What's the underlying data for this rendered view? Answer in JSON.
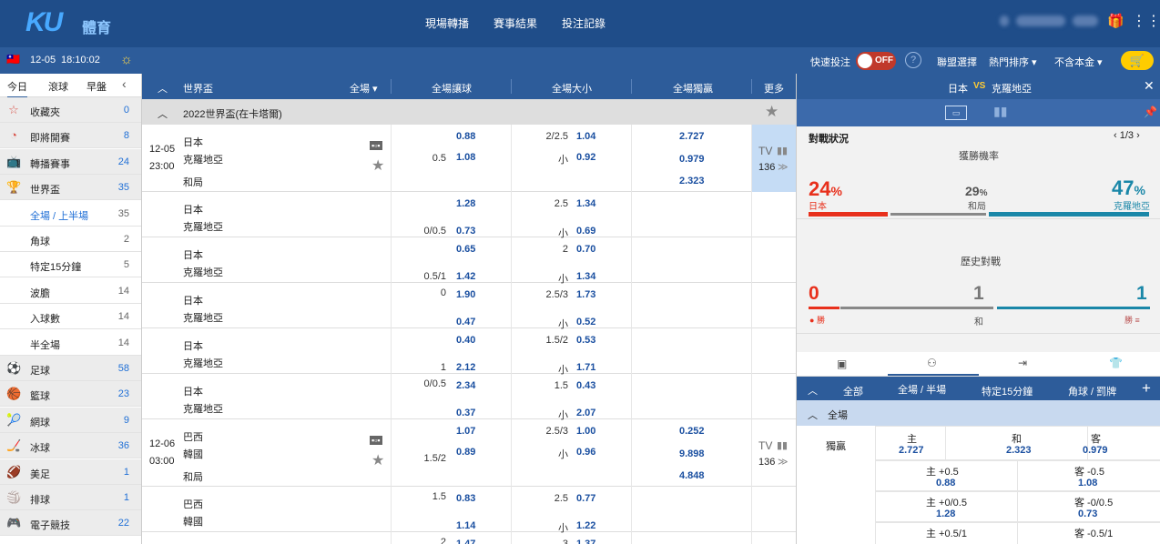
{
  "header": {
    "logo": "KU",
    "logo_sub": "體育",
    "nav": [
      "現場轉播",
      "賽事結果",
      "投注記錄"
    ]
  },
  "subbar": {
    "date": "12-05",
    "time": "18:10:02",
    "quick_bet": "快速投注",
    "toggle": "OFF",
    "league_select": "聯盟選擇",
    "sort": "熱門排序",
    "stake": "不含本金"
  },
  "left": {
    "tabs": [
      "今日",
      "滾球",
      "早盤"
    ],
    "items": [
      {
        "icon": "☆",
        "label": "收藏夾",
        "count": "0",
        "grey": true,
        "icon_name": "star-icon"
      },
      {
        "icon": "◔",
        "label": "即將開賽",
        "count": "8",
        "grey": true,
        "icon_name": "clock-icon"
      },
      {
        "icon": "📺",
        "label": "轉播賽事",
        "count": "24",
        "grey": true,
        "icon_name": "tv-icon"
      },
      {
        "icon": "🏆",
        "label": "世界盃",
        "count": "35",
        "grey": true,
        "icon_name": "trophy-icon"
      },
      {
        "icon": "",
        "label": "全場 / 上半場",
        "count": "35",
        "sub": true,
        "active": true
      },
      {
        "icon": "",
        "label": "角球",
        "count": "2",
        "sub": true
      },
      {
        "icon": "",
        "label": "特定15分鐘",
        "count": "5",
        "sub": true
      },
      {
        "icon": "",
        "label": "波膽",
        "count": "14",
        "sub": true
      },
      {
        "icon": "",
        "label": "入球數",
        "count": "14",
        "sub": true
      },
      {
        "icon": "",
        "label": "半全場",
        "count": "14",
        "sub": true
      },
      {
        "icon": "⚽",
        "label": "足球",
        "count": "58",
        "grey": true,
        "icon_name": "soccer-icon"
      },
      {
        "icon": "🏀",
        "label": "籃球",
        "count": "23",
        "grey": true,
        "icon_name": "basketball-icon"
      },
      {
        "icon": "🎾",
        "label": "網球",
        "count": "9",
        "grey": true,
        "icon_name": "tennis-icon"
      },
      {
        "icon": "🏒",
        "label": "冰球",
        "count": "36",
        "grey": true,
        "icon_name": "hockey-icon"
      },
      {
        "icon": "🏈",
        "label": "美足",
        "count": "1",
        "grey": true,
        "icon_name": "football-icon"
      },
      {
        "icon": "🏐",
        "label": "排球",
        "count": "1",
        "grey": true,
        "icon_name": "volleyball-icon"
      },
      {
        "icon": "🎮",
        "label": "電子競技",
        "count": "22",
        "grey": true,
        "icon_name": "esports-icon"
      }
    ]
  },
  "center": {
    "header": {
      "league": "世界盃",
      "period": "全場",
      "h1": "全場讓球",
      "h2": "全場大小",
      "h3": "全場獨贏",
      "more": "更多"
    },
    "league_name": "2022世界盃(在卡塔爾)",
    "rows": [
      {
        "date": "12-05",
        "time": "23:00",
        "home": "日本",
        "away": "克羅地亞",
        "draw": "和局",
        "hdp_line": "0.5",
        "hdp_home": "0.88",
        "hdp_away": "1.08",
        "ou_line": "2/2.5",
        "ou_under": "小",
        "ou_over": "1.04",
        "ou_u": "0.92",
        "x1": "2.727",
        "x2": "0.979",
        "xd": "2.323",
        "tv": "TV",
        "more": "136"
      },
      {
        "home": "日本",
        "away": "克羅地亞",
        "hdp_line": "0/0.5",
        "hdp_home": "1.28",
        "hdp_away": "0.73",
        "ou_line": "2.5",
        "ou_under": "小",
        "ou_over": "1.34",
        "ou_u": "0.69"
      },
      {
        "home": "日本",
        "away": "克羅地亞",
        "hdp_line": "0.5/1",
        "hdp_home": "0.65",
        "hdp_away": "1.42",
        "ou_line": "2",
        "ou_under": "小",
        "ou_over": "0.70",
        "ou_u": "1.34"
      },
      {
        "home": "日本",
        "away": "克羅地亞",
        "hdp_line": "0",
        "hdp_home": "1.90",
        "hdp_away": "0.47",
        "ou_line": "2.5/3",
        "ou_under": "小",
        "ou_over": "1.73",
        "ou_u": "0.52"
      },
      {
        "home": "日本",
        "away": "克羅地亞",
        "hdp_line": "1",
        "hdp_home": "0.40",
        "hdp_away": "2.12",
        "ou_line": "1.5/2",
        "ou_under": "小",
        "ou_over": "0.53",
        "ou_u": "1.71"
      },
      {
        "home": "日本",
        "away": "克羅地亞",
        "hdp_line": "0/0.5",
        "hdp_home": "2.34",
        "hdp_away": "0.37",
        "ou_line": "1.5",
        "ou_under": "小",
        "ou_over": "0.43",
        "ou_u": "2.07"
      },
      {
        "date": "12-06",
        "time": "03:00",
        "home": "巴西",
        "away": "韓國",
        "draw": "和局",
        "hdp_line": "1.5/2",
        "hdp_home": "1.07",
        "hdp_away": "0.89",
        "ou_line": "2.5/3",
        "ou_under": "小",
        "ou_over": "1.00",
        "ou_u": "0.96",
        "x1": "0.252",
        "x2": "9.898",
        "xd": "4.848",
        "tv": "TV",
        "more": "136"
      },
      {
        "home": "巴西",
        "away": "韓國",
        "hdp_line": "1.5",
        "hdp_home": "0.83",
        "hdp_away": "1.14",
        "ou_line": "2.5",
        "ou_under": "小",
        "ou_over": "0.77",
        "ou_u": "1.22"
      },
      {
        "home": "巴西",
        "hdp_line": "2",
        "hdp_home": "1.47",
        "ou_line": "3",
        "ou_over": "1.37"
      }
    ]
  },
  "right": {
    "title_home": "日本",
    "vs": "VS",
    "title_away": "克羅地亞",
    "stats_title": "對戰狀況",
    "page": "1/3",
    "win_prob": "獲勝機率",
    "p_home": "24",
    "p_draw": "29",
    "p_away": "47",
    "pct": "%",
    "l_home": "日本",
    "l_draw": "和局",
    "l_away": "克羅地亞",
    "h2h": "歷史對戰",
    "h_home": "0",
    "h_draw": "1",
    "h_away": "1",
    "h_win": "勝",
    "h_tie": "和",
    "tabs": [
      "全部",
      "全場 / 半場",
      "特定15分鐘",
      "角球 / 罰牌"
    ],
    "section": "全場",
    "market": "獨贏",
    "x_home": "主",
    "x_draw": "和",
    "x_away": "客",
    "x1": "2.727",
    "xd": "2.323",
    "x2": "0.979",
    "hdp": [
      {
        "hl": "主 +0.5",
        "ho": "0.88",
        "al": "客 -0.5",
        "ao": "1.08"
      },
      {
        "hl": "主 +0/0.5",
        "ho": "1.28",
        "al": "客 -0/0.5",
        "ao": "0.73"
      },
      {
        "hl": "主 +0.5/1",
        "ho": "",
        "al": "客 -0.5/1",
        "ao": ""
      }
    ]
  },
  "colors": {
    "topbar": "#1f4d89",
    "accent": "#2d5c9a",
    "odds": "#1a4fa0",
    "home": "#e8301c",
    "away": "#1a87a8"
  }
}
